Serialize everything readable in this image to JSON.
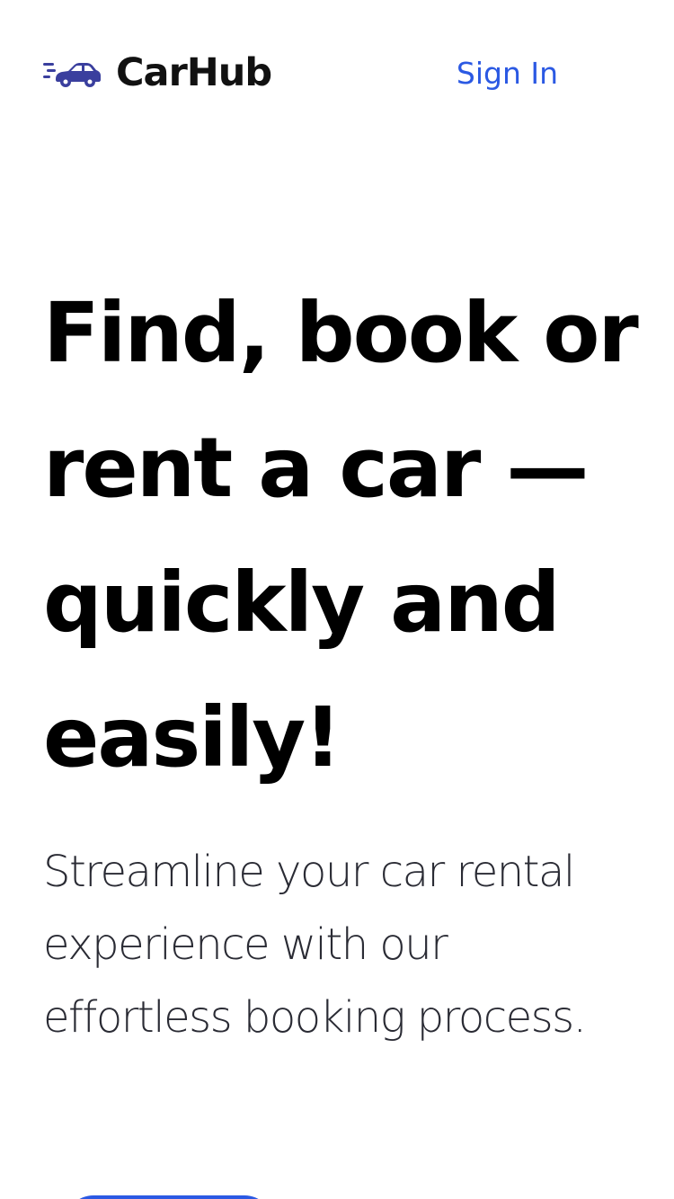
{
  "brand": {
    "name": "CarHub",
    "logo_icon": "speeding-car-icon",
    "logo_color": "#3a3f9e"
  },
  "header": {
    "sign_in_label": "Sign In"
  },
  "hero": {
    "title": "Find, book or rent a car — quickly and easily!",
    "subtitle": "Streamline your car rental experience with our effortless booking process."
  },
  "colors": {
    "accent": "#2b59e3",
    "text": "#000000",
    "muted_text": "#2a2b34",
    "background": "#ffffff"
  }
}
